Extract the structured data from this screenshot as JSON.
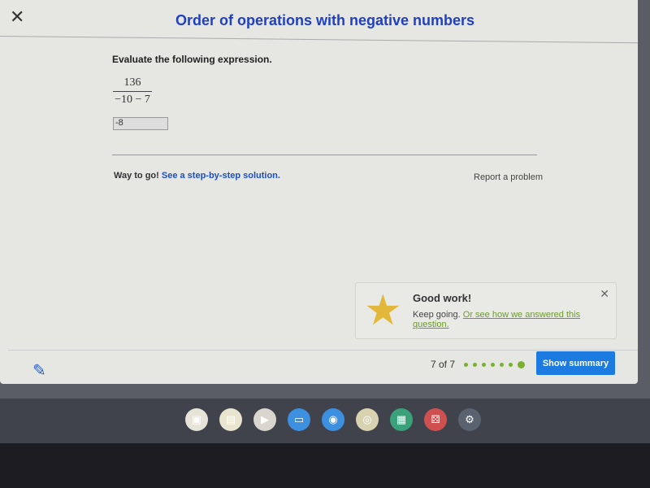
{
  "modal": {
    "title": "Order of operations with negative numbers",
    "close_icon": "close-icon"
  },
  "question": {
    "prompt": "Evaluate the following expression.",
    "numerator": "136",
    "denominator": "−10 − 7",
    "answer_value": "-8"
  },
  "feedback": {
    "text": "Way to go!",
    "link": "See a step-by-step solution.",
    "report": "Report a problem"
  },
  "toast": {
    "title": "Good work!",
    "body": "Keep going.",
    "link": "Or see how we answered this question.",
    "icon": "star-icon"
  },
  "footer": {
    "progress": "7 of 7",
    "total_dots": 7,
    "current_dot": 7,
    "button": "Show summary",
    "accent": "#1b7be0",
    "dot_color": "#7ab030"
  },
  "shelf": {
    "apps": [
      {
        "name": "gallery",
        "color": "#e6e3d8"
      },
      {
        "name": "classroom",
        "color": "#e8e4cf"
      },
      {
        "name": "youtube",
        "color": "#d9d6cf"
      },
      {
        "name": "files",
        "color": "#3d8fe0"
      },
      {
        "name": "camera",
        "color": "#3d8fe0"
      },
      {
        "name": "chrome",
        "color": "#d8d2b0"
      },
      {
        "name": "calculator",
        "color": "#3aa17a"
      },
      {
        "name": "dice-app",
        "color": "#d05050"
      },
      {
        "name": "settings",
        "color": "#5a6270"
      }
    ]
  }
}
